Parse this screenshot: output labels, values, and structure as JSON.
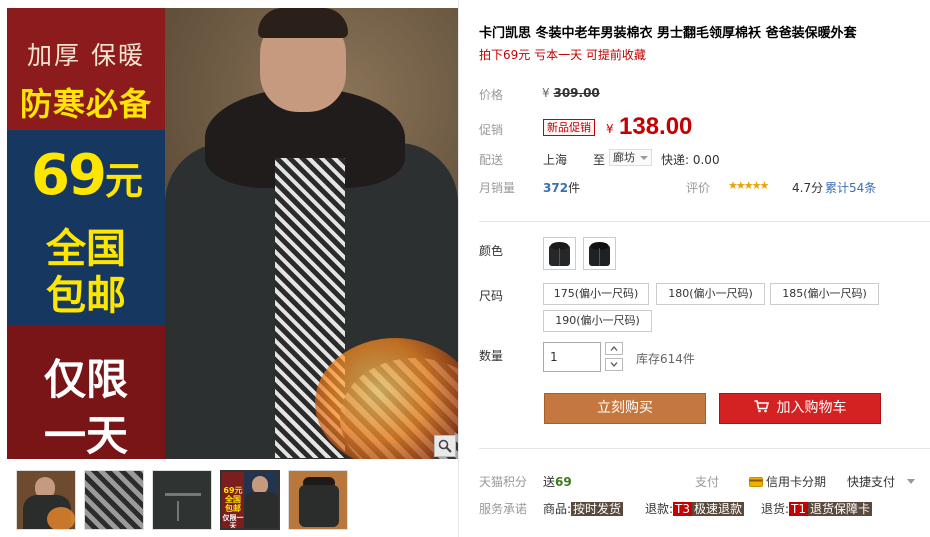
{
  "gallery": {
    "promo": {
      "line1": "加厚 保暖",
      "line2": "防寒必备",
      "price_num": "69",
      "price_unit": "元",
      "free1": "全国",
      "free2": "包邮",
      "only1": "仅限",
      "only2": "一天"
    },
    "thumbnails": [
      {
        "name": "thumb-1",
        "color": "#8a5a36"
      },
      {
        "name": "thumb-2",
        "color": "#3c3c3c"
      },
      {
        "name": "thumb-3",
        "color": "#2f3432"
      },
      {
        "name": "thumb-4",
        "color": "#7a1e1e"
      },
      {
        "name": "thumb-5",
        "color": "#a26a3a"
      }
    ],
    "thumb_mini_text": {
      "price": "69元",
      "free": "全国包邮",
      "only": "仅限一天"
    }
  },
  "product": {
    "title": "卡门凯思 冬装中老年男装棉衣 男士翻毛领厚棉袄 爸爸装保暖外套",
    "subtitle": "拍下69元 亏本一天 可提前收藏"
  },
  "pricing": {
    "price_label": "价格",
    "currency": "¥",
    "original_price": "309.00",
    "promo_label": "促销",
    "promo_badge": "新品促销",
    "promo_price": "138.00",
    "shipping_label": "配送",
    "ship_from": "上海",
    "ship_to_word": "至",
    "ship_to_city": "廊坊",
    "express": "快递: 0.00",
    "monthly_label": "月销量",
    "monthly_count": "372",
    "monthly_unit": "件",
    "rating_label": "评价",
    "stars": "★★★★★",
    "score": "4.7分",
    "reviews": "累计54条"
  },
  "options": {
    "color_label": "颜色",
    "size_label": "尺码",
    "sizes": [
      "175(偏小一尺码)",
      "180(偏小一尺码)",
      "185(偏小一尺码)",
      "190(偏小一尺码)"
    ],
    "quantity_label": "数量",
    "quantity_value": "1",
    "stock": "库存614件"
  },
  "actions": {
    "buy_now": "立刻购买",
    "add_to_cart": "加入购物车"
  },
  "footer": {
    "points_label": "天猫积分",
    "points_give": "送",
    "points_value": "69",
    "pay_label": "支付",
    "credit_installment": "信用卡分期",
    "quick_pay": "快捷支付",
    "service_label": "服务承诺",
    "goods_label": "商品:",
    "goods_tag": "按时发货",
    "refund_label": "退款:",
    "refund_t": "T3",
    "refund_tag": "极速退款",
    "return_label": "退货:",
    "return_t": "T1",
    "return_tag": "退货保障卡"
  }
}
